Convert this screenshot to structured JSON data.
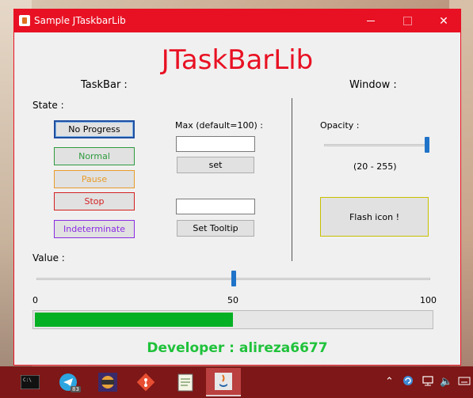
{
  "window": {
    "title": "Sample JTaskbarLib",
    "brand": "JTaskBarLib"
  },
  "taskbar_section": {
    "heading": "TaskBar :",
    "state_label": "State :",
    "buttons": {
      "no_progress": "No Progress",
      "normal": "Normal",
      "pause": "Pause",
      "stop": "Stop",
      "indeterminate": "Indeterminate"
    },
    "max_label": "Max (default=100) :",
    "max_value": "",
    "set_button": "set",
    "tooltip_value": "",
    "set_tooltip_button": "Set Tooltip",
    "value_label": "Value :",
    "slider": {
      "min": "0",
      "mid": "50",
      "max": "100",
      "value": 50
    },
    "progress": {
      "value": 50,
      "max": 100
    }
  },
  "window_section": {
    "heading": "Window :",
    "opacity_label": "Opacity :",
    "opacity_range": "(20 - 255)",
    "opacity_value": 255,
    "flash_button": "Flash icon !"
  },
  "developer": "Developer : alireza6677",
  "colors": {
    "accent_red": "#e81123",
    "normal_green": "#2e9b3f",
    "pause_orange": "#e89b2a",
    "stop_red": "#d32020",
    "indeterminate_purple": "#8a2be2",
    "progress_green": "#06b025",
    "developer_green": "#1fc23a"
  },
  "os_taskbar": {
    "telegram_badge": "83",
    "icons": [
      "terminal-icon",
      "telegram-icon",
      "java-ee-ide-icon",
      "git-icon",
      "notepad-icon",
      "java-icon"
    ]
  }
}
